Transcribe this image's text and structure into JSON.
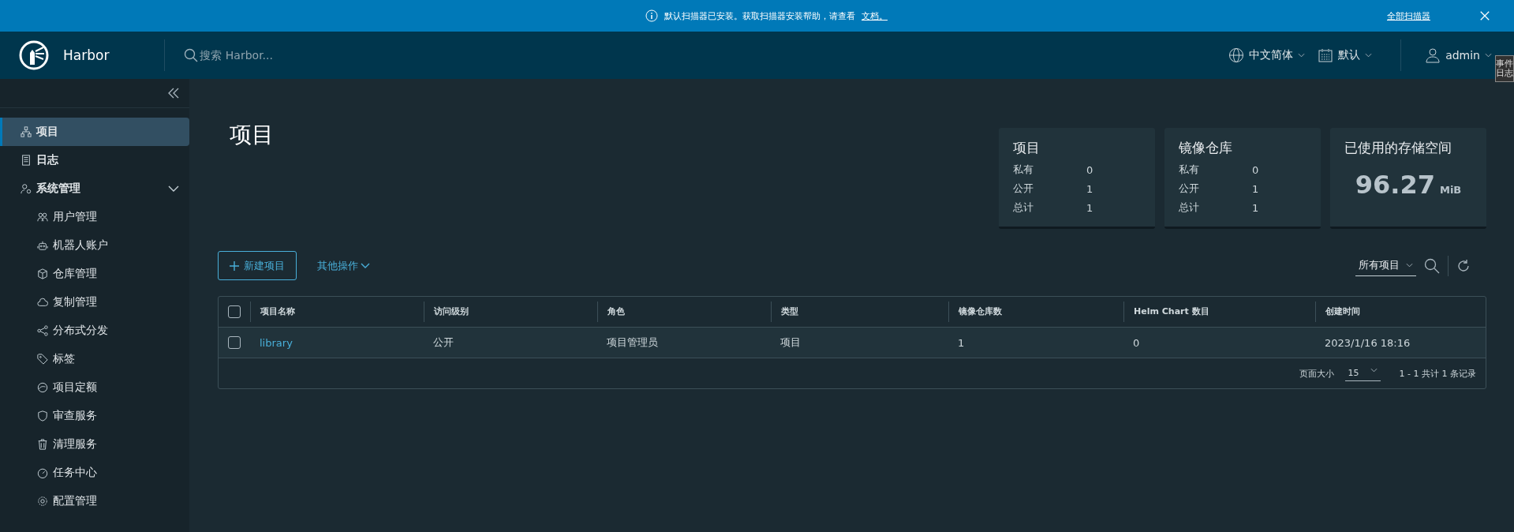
{
  "banner": {
    "message": "默认扫描器已安装。获取扫描器安装帮助，请查看",
    "link": "文档。",
    "action": "全部扫描器"
  },
  "header": {
    "brand": "Harbor",
    "search": {
      "placeholder": "搜索 Harbor..."
    },
    "language": "中文简体",
    "theme": "默认",
    "user": "admin"
  },
  "side_tab": "事件日志",
  "sidebar": {
    "items": [
      {
        "label": "项目",
        "selected": true
      },
      {
        "label": "日志",
        "selected": false
      },
      {
        "label": "系统管理",
        "selected": false,
        "expanded": true,
        "children": [
          {
            "label": "用户管理",
            "selected": false
          },
          {
            "label": "机器人账户",
            "selected": false
          },
          {
            "label": "仓库管理",
            "selected": false
          },
          {
            "label": "复制管理",
            "selected": false
          },
          {
            "label": "分布式分发",
            "selected": false
          },
          {
            "label": "标签",
            "selected": false
          },
          {
            "label": "项目定额",
            "selected": false
          },
          {
            "label": "审查服务",
            "selected": false
          },
          {
            "label": "清理服务",
            "selected": false
          },
          {
            "label": "任务中心",
            "selected": false
          },
          {
            "label": "配置管理",
            "selected": false
          }
        ]
      }
    ]
  },
  "page_title": "项目",
  "cards": [
    {
      "kind": "list",
      "title": "项目",
      "rows": [
        {
          "label": "私有",
          "value": "0"
        },
        {
          "label": "公开",
          "value": "1"
        },
        {
          "label": "总计",
          "value": "1"
        }
      ]
    },
    {
      "kind": "list",
      "title": "镜像仓库",
      "rows": [
        {
          "label": "私有",
          "value": "0"
        },
        {
          "label": "公开",
          "value": "1"
        },
        {
          "label": "总计",
          "value": "1"
        }
      ]
    },
    {
      "kind": "big",
      "title": "已使用的存储空间",
      "value": "96.27",
      "unit": "MiB"
    }
  ],
  "toolbar": {
    "new_button": "新建项目",
    "more_actions": "其他操作",
    "filter": "所有项目"
  },
  "table": {
    "all_selected": false,
    "columns": [
      "项目名称",
      "访问级别",
      "角色",
      "类型",
      "镜像仓库数",
      "Helm Chart 数目",
      "创建时间"
    ],
    "rows": [
      {
        "selected": false,
        "cells": [
          "library",
          "公开",
          "项目管理员",
          "项目",
          "1",
          "0",
          "2023/1/16 18:16"
        ]
      }
    ],
    "footer": {
      "page_size_label": "页面大小",
      "page_size": "15",
      "summary": "1 - 1 共计 1 条记录"
    }
  }
}
